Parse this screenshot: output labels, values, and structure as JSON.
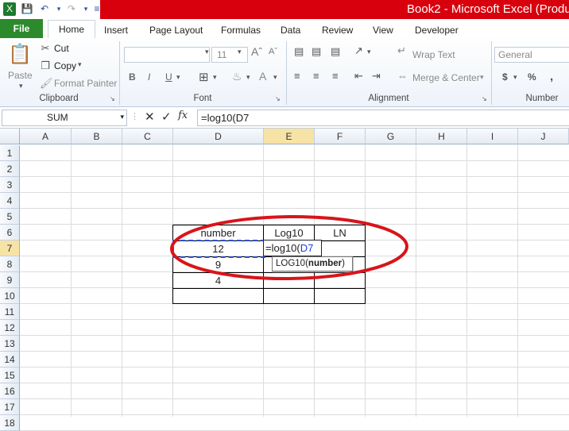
{
  "app": {
    "title": "Book2 -  Microsoft Excel (Produ"
  },
  "tabs": [
    "File",
    "Home",
    "Insert",
    "Page Layout",
    "Formulas",
    "Data",
    "Review",
    "View",
    "Developer"
  ],
  "ribbon": {
    "clipboard": {
      "label": "Clipboard",
      "paste": "Paste",
      "cut": "Cut",
      "copy": "Copy",
      "format_painter": "Format Painter"
    },
    "font": {
      "label": "Font",
      "size": "11",
      "bold": "B",
      "italic": "I",
      "underline": "U"
    },
    "alignment": {
      "label": "Alignment",
      "wrap_text": "Wrap Text",
      "merge_center": "Merge & Center"
    },
    "number": {
      "label": "Number",
      "format": "General",
      "currency": "$",
      "percent": "%",
      "comma": ","
    }
  },
  "formula_bar": {
    "name_box": "SUM",
    "formula": "=log10(D7",
    "fx": "fx"
  },
  "columns": [
    "A",
    "B",
    "C",
    "D",
    "E",
    "F",
    "G",
    "H",
    "I",
    "J"
  ],
  "rows": [
    "1",
    "2",
    "3",
    "4",
    "5",
    "6",
    "7",
    "8",
    "9",
    "10",
    "11",
    "12",
    "13",
    "14",
    "15",
    "16",
    "17",
    "18"
  ],
  "table": {
    "headers": [
      "number",
      "Log10",
      "LN"
    ],
    "values": [
      "12",
      "9",
      "4"
    ],
    "editing_prefix": "=log10(",
    "editing_ref": "D7"
  },
  "tooltip": {
    "func": "LOG10(",
    "arg": "number",
    "close": ")"
  },
  "colors": {
    "title_bar": "#d9000d",
    "file_tab": "#2c8a2c",
    "annotation_ellipse": "#d8141b",
    "ref_blue": "#1a3fd6"
  }
}
